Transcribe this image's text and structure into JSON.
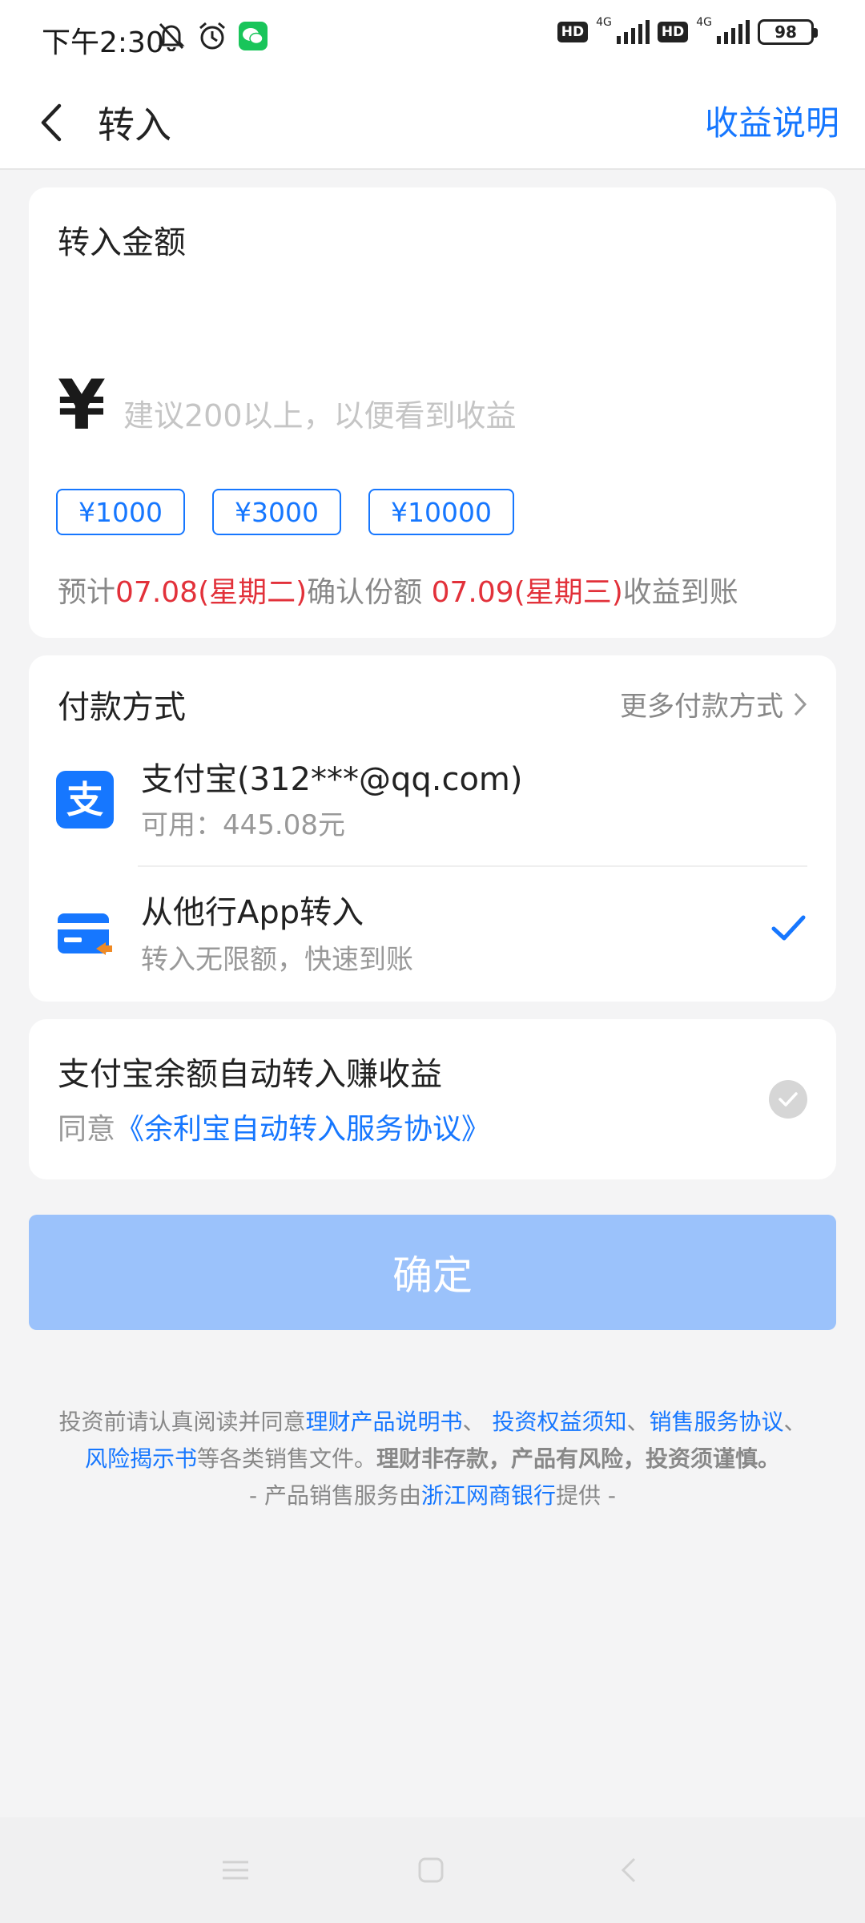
{
  "status_bar": {
    "time": "下午2:30",
    "icons": [
      "bell-off-icon",
      "alarm-icon",
      "wechat-icon",
      "hd-icon",
      "signal-4g-icon",
      "hd-icon",
      "signal-4g-icon"
    ],
    "hd": "HD",
    "net": "4G",
    "battery": "98"
  },
  "nav": {
    "title": "转入",
    "action": "收益说明"
  },
  "amount_card": {
    "title": "转入金额",
    "currency": "¥",
    "placeholder": "建议200以上，以便看到收益",
    "quick_amounts": [
      "¥1000",
      "¥3000",
      "¥10000"
    ],
    "estimate": {
      "prefix": "预计",
      "confirm_date": "07.08(星期二)",
      "middle": "确认份额 ",
      "income_date": "07.09(星期三)",
      "suffix": "收益到账"
    }
  },
  "payment_card": {
    "title": "付款方式",
    "more": "更多付款方式",
    "methods": [
      {
        "name": "支付宝(312***@qq.com)",
        "sub": "可用：445.08元",
        "icon": "alipay-icon",
        "selected": false
      },
      {
        "name": "从他行App转入",
        "sub": "转入无限额，快速到账",
        "icon": "bank-card-icon",
        "selected": true
      }
    ]
  },
  "auto_card": {
    "title": "支付宝余额自动转入赚收益",
    "agree_prefix": "同意",
    "agree_link": "《余利宝自动转入服务协议》"
  },
  "confirm_button": "确定",
  "disclaimer": {
    "prefix": "投资前请认真阅读并同意",
    "link1": "理财产品说明书",
    "sep1": "、 ",
    "link2": "投资权益须知",
    "sep2": "、",
    "link3": "销售服务协议",
    "sep3": "、",
    "link4": "风险揭示书",
    "middle": "等各类销售文件。",
    "warning": "理财非存款，产品有风险，投资须谨慎。",
    "provider_prefix": "- 产品销售服务由",
    "provider_link": "浙江网商银行",
    "provider_suffix": "提供 -"
  },
  "colors": {
    "accent": "#1677ff",
    "highlight": "#e2313a",
    "confirm_disabled": "#9bc2fb"
  }
}
